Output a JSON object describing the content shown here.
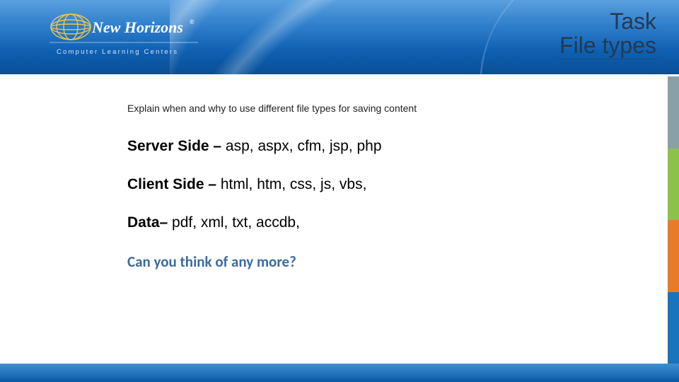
{
  "brand": {
    "name": "New Horizons",
    "tagline": "Computer Learning Centers",
    "registered": "®"
  },
  "title": {
    "line1": "Task",
    "line2": "File types"
  },
  "instruction": "Explain when and why to use different file types for saving content",
  "rows": [
    {
      "label": "Server Side – ",
      "value": "asp, aspx, cfm, jsp, php"
    },
    {
      "label": "Client Side – ",
      "value": "html, htm, css, js, vbs,"
    },
    {
      "label": "Data– ",
      "value": "pdf, xml, txt, accdb,"
    }
  ],
  "question": "Can you think of any more?",
  "accent_colors": [
    "#8aa0a8",
    "#8bc34a",
    "#e87b28",
    "#1a74bd"
  ]
}
